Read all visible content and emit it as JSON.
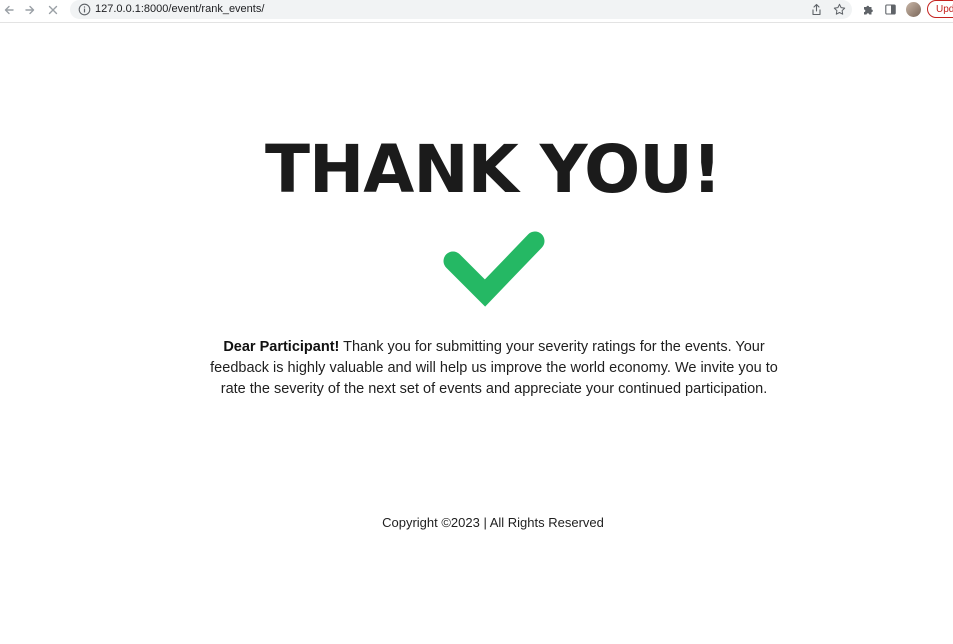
{
  "browser": {
    "url": "127.0.0.1:8000/event/rank_events/",
    "update_label": "Upd"
  },
  "page": {
    "heading": "THANK YOU!",
    "greeting": "Dear Participant!",
    "message": "Thank you for submitting your severity ratings for the events. Your feedback is highly valuable and will help us improve the world economy. We invite you to rate the severity of the next set of events and appreciate your continued participation.",
    "footer": "Copyright ©2023 | All Rights Reserved"
  },
  "colors": {
    "check": "#25b864",
    "text": "#1b1b1b"
  },
  "icons": [
    "back-icon",
    "forward-icon",
    "stop-icon",
    "info-icon",
    "share-icon",
    "star-icon",
    "extensions-icon",
    "side-panel-icon",
    "check-icon"
  ]
}
